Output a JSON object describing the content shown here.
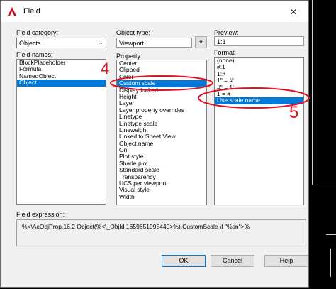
{
  "window": {
    "title": "Field"
  },
  "field_category": {
    "label": "Field category:",
    "value": "Objects"
  },
  "field_names": {
    "label": "Field names:",
    "items": [
      "BlockPlaceholder",
      "Formula",
      "NamedObject",
      "Object"
    ],
    "selected_index": 3
  },
  "object_type": {
    "label": "Object type:",
    "value": "Viewport"
  },
  "property": {
    "label": "Property:",
    "items": [
      "Center",
      "Clipped",
      "Color",
      "Custom scale",
      "Display locked",
      "Height",
      "Layer",
      "Layer property overrides",
      "Linetype",
      "Linetype scale",
      "Lineweight",
      "Linked to Sheet View",
      "Object name",
      "On",
      "Plot style",
      "Shade plot",
      "Standard scale",
      "Transparency",
      "UCS per viewport",
      "Visual style",
      "Width"
    ],
    "selected_index": 3
  },
  "preview": {
    "label": "Preview:",
    "value": "1:1"
  },
  "format": {
    "label": "Format:",
    "items": [
      "(none)",
      "#:1",
      "1:#",
      "1\" = #'",
      "#\" = 1'",
      "1 = #",
      "Use scale name"
    ],
    "selected_index": 6
  },
  "field_expression": {
    "label": "Field expression:",
    "value": "%<\\AcObjProp.16.2 Object(%<\\_ObjId 1659851995440>%).CustomScale \\f \"%sn\">%"
  },
  "buttons": {
    "ok": "OK",
    "cancel": "Cancel",
    "help": "Help"
  },
  "annotations": {
    "mark_left": "4",
    "mark_right": "5",
    "ink_color": "#e0101e"
  },
  "colors": {
    "selection": "#0078d7",
    "dialog_bg": "#f0f0f0"
  }
}
